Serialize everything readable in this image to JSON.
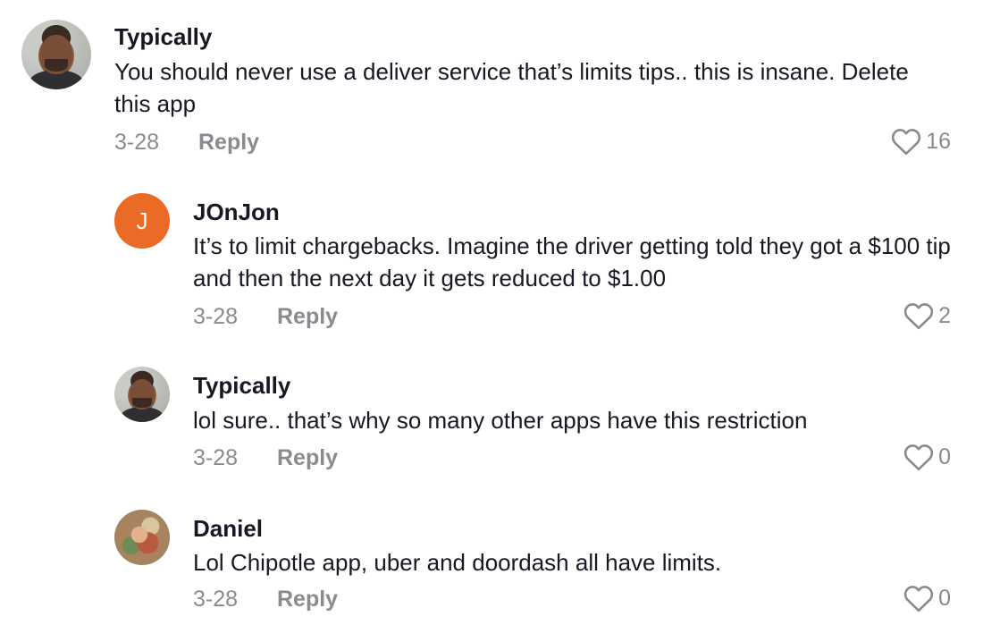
{
  "comments": [
    {
      "username": "Typically",
      "text": "You should never use a deliver service that’s limits tips.. this is insane. Delete this app",
      "date": "3-28",
      "reply_label": "Reply",
      "likes": "16",
      "avatar": "photo-man"
    },
    {
      "username": "JOnJon",
      "text": "It’s to limit chargebacks. Imagine the driver getting told they got a $100 tip and then the next day it gets reduced to $1.00",
      "date": "3-28",
      "reply_label": "Reply",
      "likes": "2",
      "avatar_initial": "J",
      "avatar_color": "#ea6a26"
    },
    {
      "username": "Typically",
      "text": "lol sure.. that’s why so many other apps have this restriction",
      "date": "3-28",
      "reply_label": "Reply",
      "likes": "0",
      "avatar": "photo-man"
    },
    {
      "username": "Daniel",
      "text": "Lol Chipotle app, uber and doordash all have limits.",
      "date": "3-28",
      "reply_label": "Reply",
      "likes": "0",
      "avatar": "photo-collage"
    }
  ],
  "icons": {
    "like": "heart-outline-icon"
  },
  "colors": {
    "text": "#161823",
    "muted": "#8a8b91",
    "initial_avatar": "#ea6a26"
  }
}
